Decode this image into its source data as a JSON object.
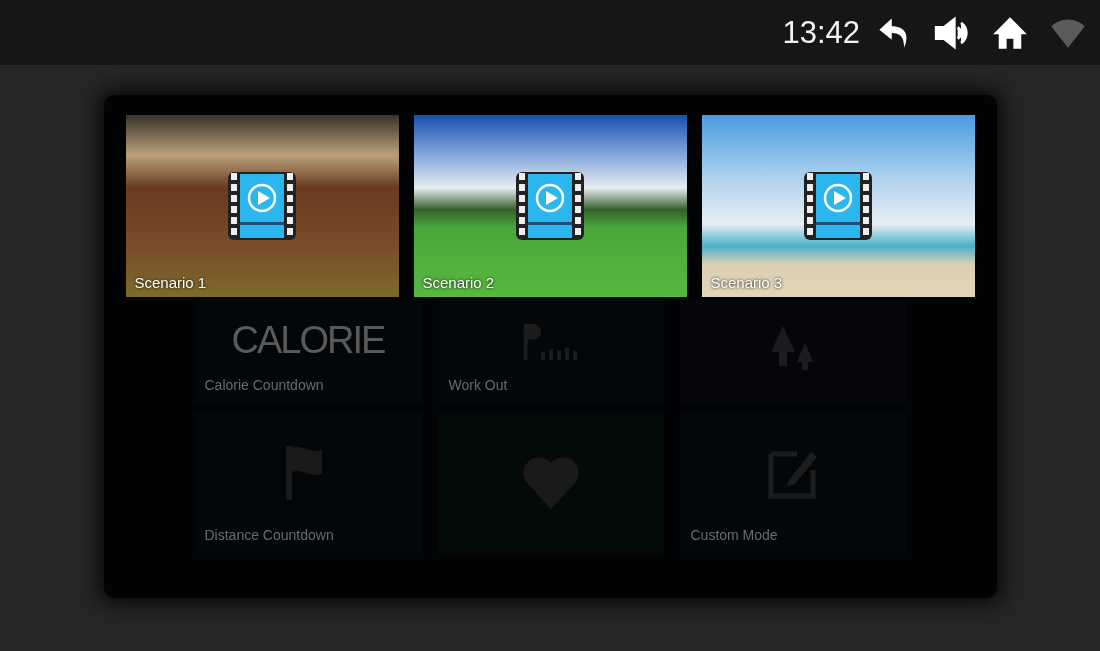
{
  "status_bar": {
    "time": "13:42"
  },
  "scenarios": [
    {
      "label": "Scenario 1",
      "kind": "canyon"
    },
    {
      "label": "Scenario 2",
      "kind": "meadow"
    },
    {
      "label": "Scenario 3",
      "kind": "beach"
    }
  ],
  "programs": [
    {
      "label": "Calorie Countdown",
      "kind": "calorie",
      "logo": "CALORIE"
    },
    {
      "label": "Work Out",
      "kind": "chart"
    },
    {
      "kind": "tree"
    },
    {
      "label": "Distance Countdown",
      "kind": "flag"
    },
    {
      "kind": "heart"
    },
    {
      "label": "Custom Mode",
      "kind": "edit"
    }
  ]
}
